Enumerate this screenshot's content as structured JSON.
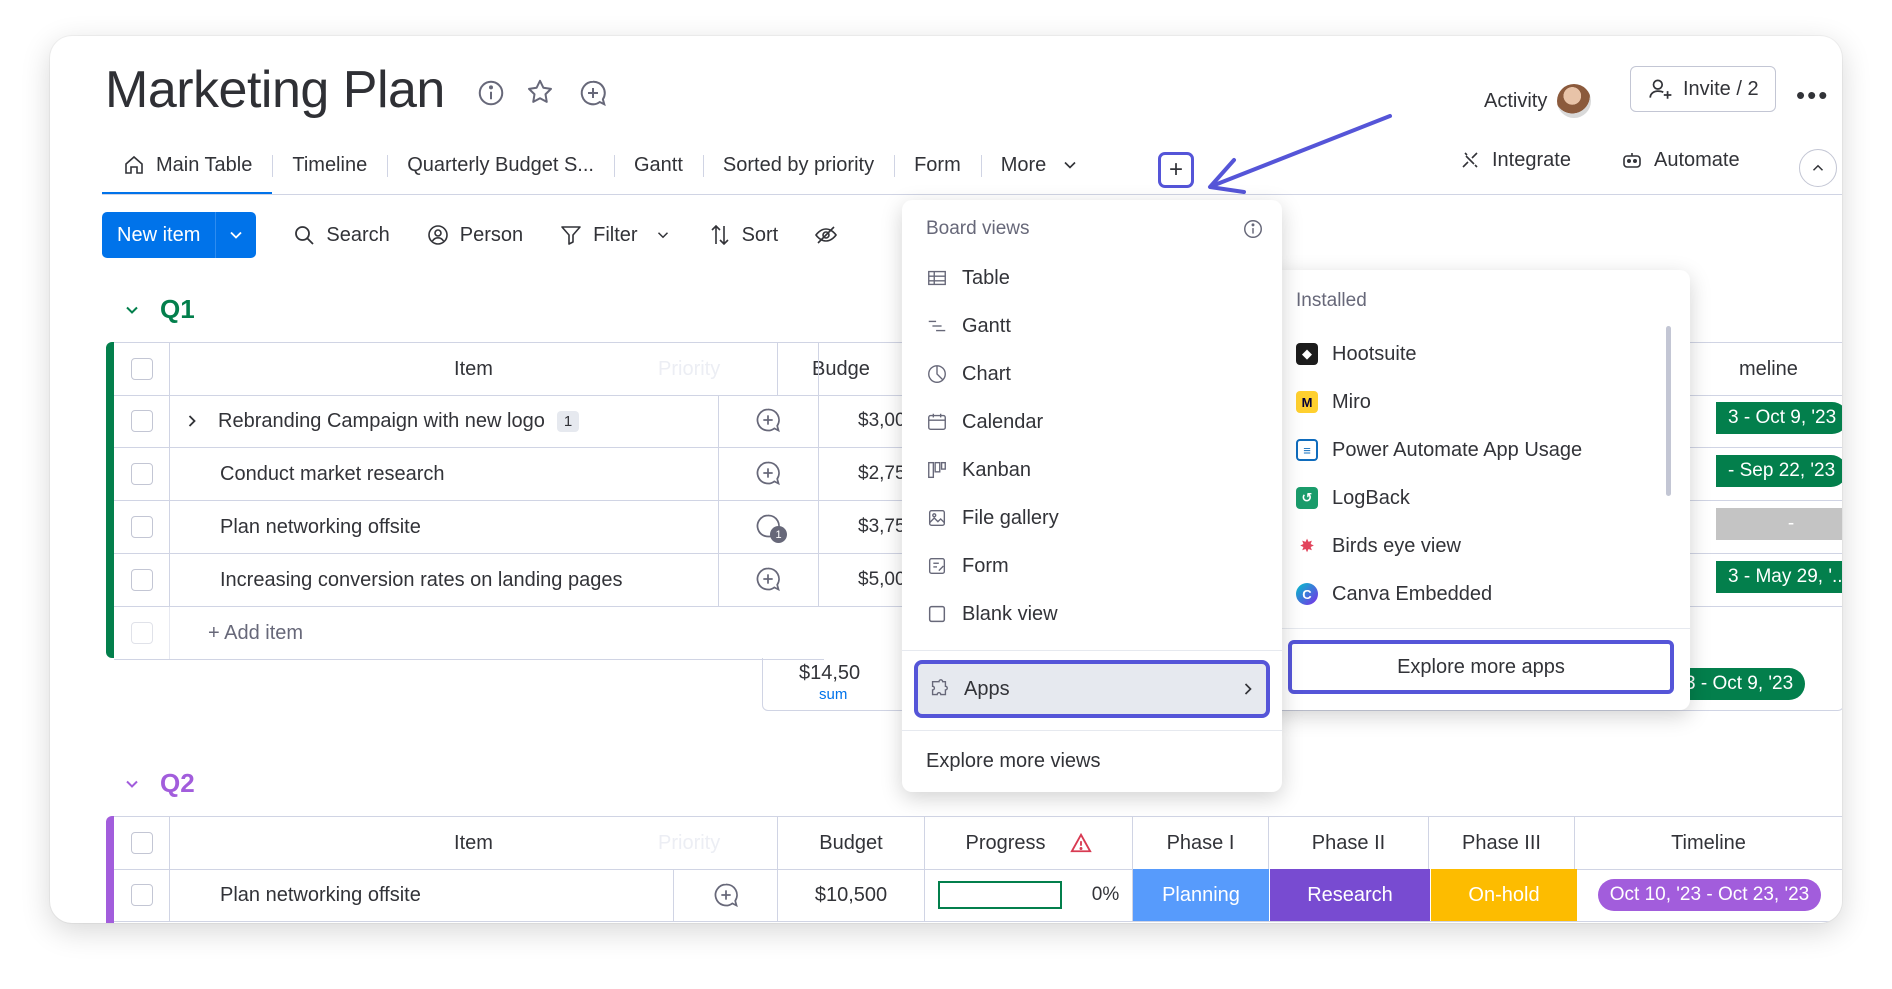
{
  "board": {
    "title": "Marketing Plan"
  },
  "tabs": [
    {
      "label": "Main Table"
    },
    {
      "label": "Timeline"
    },
    {
      "label": "Quarterly Budget S..."
    },
    {
      "label": "Gantt"
    },
    {
      "label": "Sorted by priority"
    },
    {
      "label": "Form"
    },
    {
      "label": "More"
    }
  ],
  "header": {
    "activity": "Activity",
    "invite": "Invite / 2",
    "integrate": "Integrate",
    "automate": "Automate"
  },
  "toolbar": {
    "new_item": "New item",
    "search": "Search",
    "person": "Person",
    "filter": "Filter",
    "sort": "Sort"
  },
  "groups": {
    "q1": {
      "name": "Q1",
      "color": "#037f4c",
      "col_item": "Item",
      "col_priority_ghost": "Priority",
      "col_budget": "Budge",
      "col_timeline": "meline",
      "rows": [
        {
          "name": "Rebranding Campaign with new logo",
          "count": "1",
          "budget": "$3,000",
          "timeline": "3 - Oct 9, '23"
        },
        {
          "name": "Conduct market research",
          "budget": "$2,750",
          "timeline": "- Sep 22, '23"
        },
        {
          "name": "Plan networking offsite",
          "budget": "$3,750",
          "comments": "1",
          "timeline": "-"
        },
        {
          "name": "Increasing conversion rates on landing pages",
          "budget": "$5,000",
          "timeline": "3 - May 29, '..."
        }
      ],
      "add_item": "+ Add item",
      "sum_value": "$14,50",
      "sum_label": "sum",
      "sum_timeline": "3 - Oct 9, '23"
    },
    "q2": {
      "name": "Q2",
      "color": "#a25ddc",
      "col_item": "Item",
      "col_priority_ghost": "Priority",
      "col_budget": "Budget",
      "col_progress": "Progress",
      "col_phase1": "Phase I",
      "col_phase2": "Phase II",
      "col_phase3": "Phase III",
      "col_timeline": "Timeline",
      "rows": [
        {
          "name": "Plan networking offsite",
          "budget": "$10,500",
          "progress": "0%",
          "phase1": "Planning",
          "phase2": "Research",
          "phase3": "On-hold",
          "timeline": "Oct 10, '23 - Oct 23, '23"
        }
      ]
    }
  },
  "views_menu": {
    "heading": "Board views",
    "items": [
      {
        "label": "Table"
      },
      {
        "label": "Gantt"
      },
      {
        "label": "Chart"
      },
      {
        "label": "Calendar"
      },
      {
        "label": "Kanban"
      },
      {
        "label": "File gallery"
      },
      {
        "label": "Form"
      },
      {
        "label": "Blank view"
      }
    ],
    "apps": "Apps",
    "explore": "Explore more views"
  },
  "apps_menu": {
    "heading": "Installed",
    "items": [
      {
        "label": "Hootsuite"
      },
      {
        "label": "Miro"
      },
      {
        "label": "Power Automate App Usage"
      },
      {
        "label": "LogBack"
      },
      {
        "label": "Birds eye view"
      },
      {
        "label": "Canva Embedded"
      }
    ],
    "explore": "Explore more apps"
  },
  "colors": {
    "primary": "#0073ea",
    "highlight": "#5555d8",
    "done_green": "#037f4c",
    "planning": "#579bfc",
    "research": "#784bd1",
    "onhold": "#fdbc00",
    "q2_timeline": "#a25ddc"
  }
}
